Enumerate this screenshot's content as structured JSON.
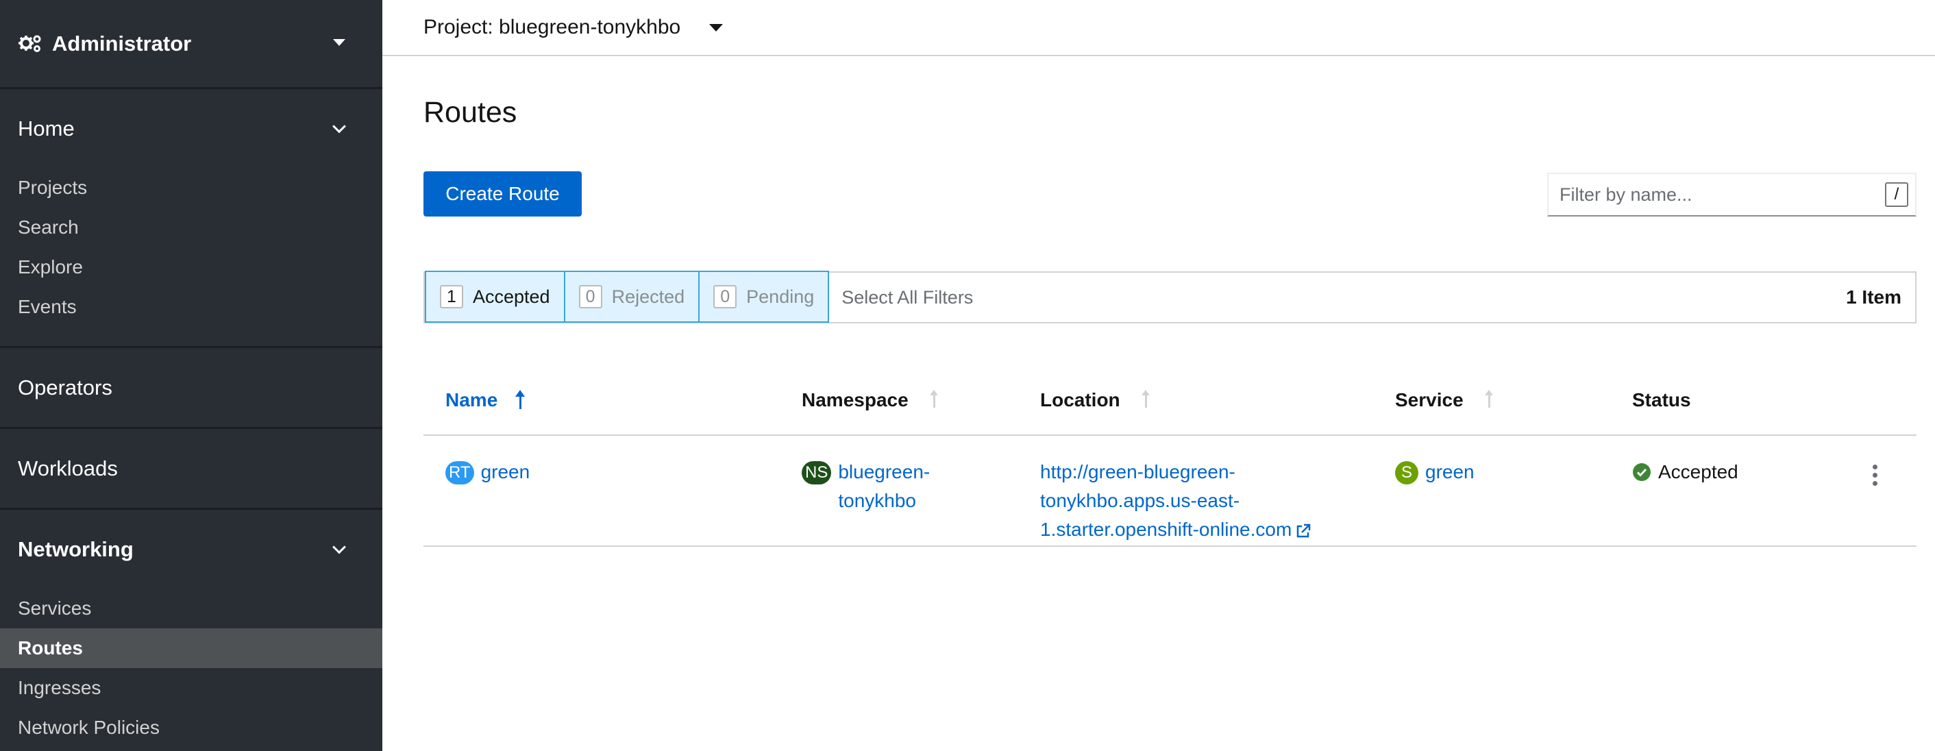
{
  "sidebar": {
    "perspective": "Administrator",
    "sections": {
      "home": {
        "label": "Home",
        "items": [
          "Projects",
          "Search",
          "Explore",
          "Events"
        ]
      },
      "operators": {
        "label": "Operators"
      },
      "workloads": {
        "label": "Workloads"
      },
      "networking": {
        "label": "Networking",
        "items": [
          "Services",
          "Routes",
          "Ingresses",
          "Network Policies"
        ],
        "active": "Routes"
      }
    }
  },
  "header": {
    "project": "Project: bluegreen-tonykhbo"
  },
  "page": {
    "title": "Routes",
    "create_button": "Create Route",
    "filter_placeholder": "Filter by name...",
    "filter_shortcut": "/"
  },
  "row_filters": {
    "accepted": {
      "count": "1",
      "label": "Accepted"
    },
    "rejected": {
      "count": "0",
      "label": "Rejected"
    },
    "pending": {
      "count": "0",
      "label": "Pending"
    },
    "select_all": "Select All Filters",
    "item_count": "1 Item"
  },
  "table": {
    "columns": {
      "name": "Name",
      "namespace": "Namespace",
      "location": "Location",
      "service": "Service",
      "status": "Status"
    },
    "rows": [
      {
        "name_badge": "RT",
        "name": "green",
        "namespace_badge": "NS",
        "namespace_line1": "bluegreen-",
        "namespace_line2": "tonykhbo",
        "location_line1": "http://green-bluegreen-",
        "location_line2": "tonykhbo.apps.us-east-",
        "location_line3": "1.starter.openshift-online.com",
        "service_badge": "S",
        "service": "green",
        "status": "Accepted"
      }
    ]
  },
  "colors": {
    "sidebar_bg": "#292e34",
    "primary": "#0066cc",
    "success": "#3e8635",
    "filter_active_bg": "#def3ff"
  },
  "icons": {
    "perspective": "gears-icon",
    "external_link": "external-link-icon",
    "status": "check-circle-icon",
    "row_actions": "kebab-icon"
  }
}
